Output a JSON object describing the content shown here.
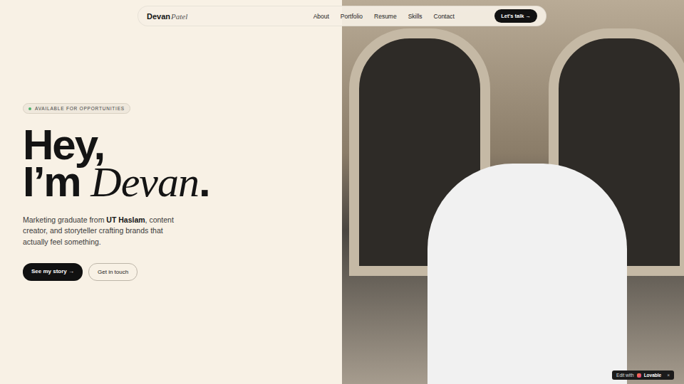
{
  "nav": {
    "logo": {
      "first": "Devan",
      "last": "Patel"
    },
    "links": [
      "About",
      "Portfolio",
      "Resume",
      "Skills",
      "Contact"
    ],
    "cta": "Let's talk →"
  },
  "hero": {
    "badge": "AVAILABLE FOR OPPORTUNITIES",
    "heading": {
      "line1": "Hey,",
      "line2_start": "I’m",
      "name": "Devan",
      "end": "."
    },
    "intro": {
      "before": "Marketing graduate from ",
      "bold": "UT Haslam",
      "after": ", content creator, and storyteller crafting brands that actually feel something."
    },
    "buttons": [
      {
        "label": "See my story →",
        "kind": "primary"
      },
      {
        "label": "Get in touch",
        "kind": "outline"
      }
    ]
  },
  "lovable": {
    "prefix": "Edit with",
    "brand": "Lovable",
    "close": "×"
  }
}
